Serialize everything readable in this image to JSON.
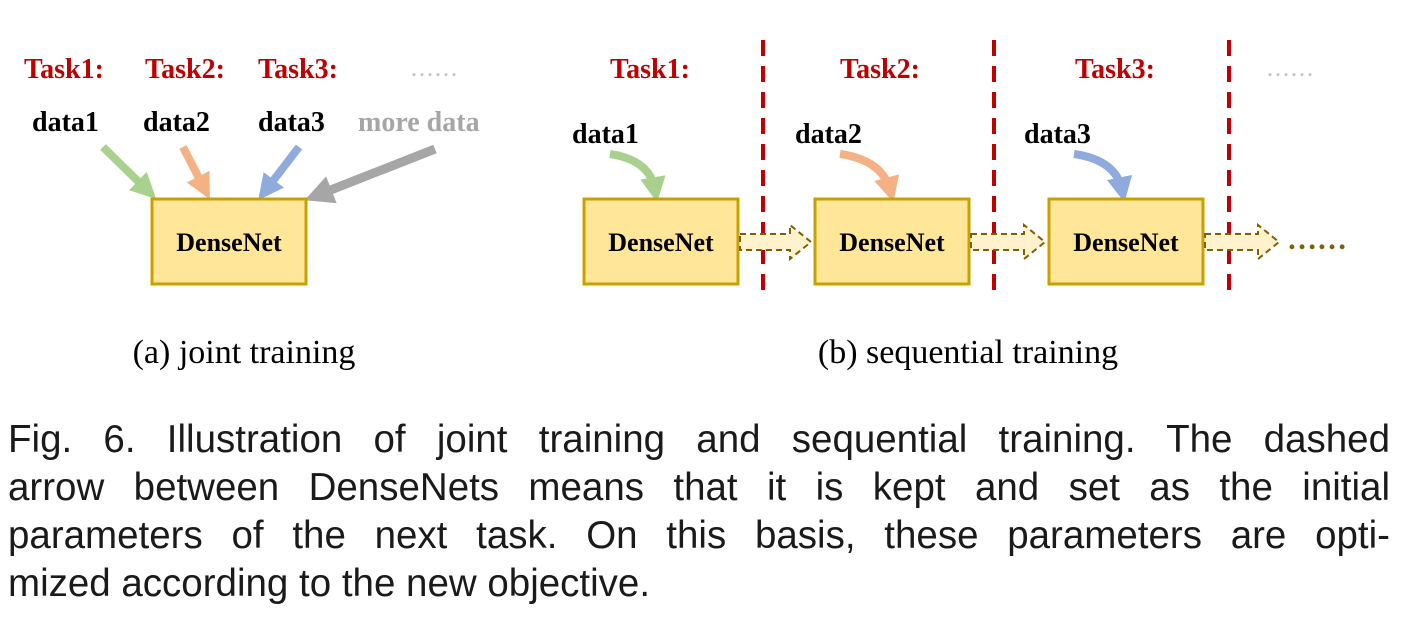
{
  "colors": {
    "task_red": "#c00000",
    "box_fill": "#ffe699",
    "box_border": "#c8a000",
    "arrow_green": "#a9d18e",
    "arrow_orange": "#f4b183",
    "arrow_blue": "#8faadc",
    "arrow_gray": "#a6a6a6",
    "dash_arrow_fill": "#fff2cc",
    "dash_arrow_stroke": "#7f6000",
    "divider_red": "#c00000",
    "ellipsis_gray": "#bfbfbf",
    "more_data_gray": "#a6a6a6"
  },
  "panel_a": {
    "tasks": [
      "Task1:",
      "Task2:",
      "Task3:"
    ],
    "ellipsis": "……",
    "data_labels": [
      "data1",
      "data2",
      "data3"
    ],
    "more_data": "more data",
    "box_label": "DenseNet",
    "subcaption": "(a) joint training"
  },
  "panel_b": {
    "tasks": [
      "Task1:",
      "Task2:",
      "Task3:"
    ],
    "ellipsis": "……",
    "data_labels": [
      "data1",
      "data2",
      "data3"
    ],
    "box_labels": [
      "DenseNet",
      "DenseNet",
      "DenseNet"
    ],
    "trailing_dots": "……",
    "subcaption": "(b) sequential training"
  },
  "caption": {
    "lines": [
      "Fig. 6. Illustration of joint training and sequential training. The dashed",
      "arrow between DenseNets means that it is kept and set as the initial",
      "parameters of the next task. On this basis, these parameters are opti-",
      "mized according to the new objective."
    ]
  }
}
